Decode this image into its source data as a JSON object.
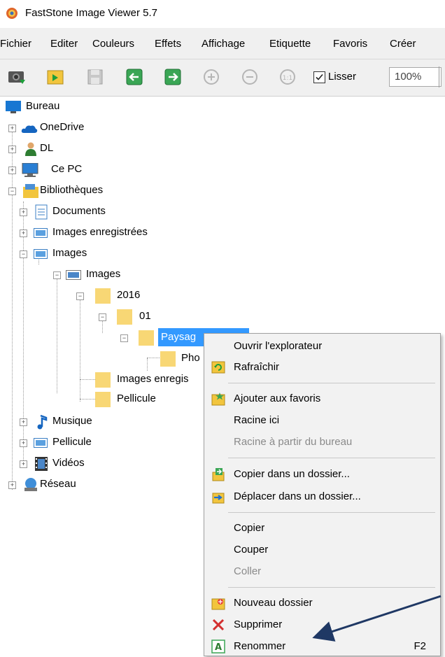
{
  "window": {
    "title": "FastStone Image Viewer 5.7"
  },
  "menubar": {
    "items": [
      "Fichier",
      "Editer",
      "Couleurs",
      "Effets",
      "Affichage",
      "Etiquette",
      "Favoris",
      "Créer"
    ]
  },
  "toolbar": {
    "smooth_label": "Lisser",
    "smooth_checked": true,
    "zoom_value": "100%"
  },
  "tree": {
    "nodes": [
      {
        "label": "Bureau",
        "icon": "desktop-icon"
      },
      {
        "label": "OneDrive",
        "icon": "cloud-icon"
      },
      {
        "label": "DL",
        "icon": "user-icon"
      },
      {
        "label": "Ce PC",
        "icon": "computer-icon"
      },
      {
        "label": "Bibliothèques",
        "icon": "library-icon"
      },
      {
        "label": "Documents",
        "icon": "documents-icon"
      },
      {
        "label": "Images enregistrées",
        "icon": "pictures-icon"
      },
      {
        "label": "Images",
        "icon": "pictures-icon"
      },
      {
        "label": "Images",
        "icon": "pictures-icon"
      },
      {
        "label": "2016",
        "icon": "folder-icon"
      },
      {
        "label": "01",
        "icon": "folder-icon"
      },
      {
        "label": "Paysag",
        "icon": "folder-icon"
      },
      {
        "label": "Pho",
        "icon": "folder-icon"
      },
      {
        "label": "Images enregis",
        "icon": "folder-icon"
      },
      {
        "label": "Pellicule",
        "icon": "folder-icon"
      },
      {
        "label": "Musique",
        "icon": "music-icon"
      },
      {
        "label": "Pellicule",
        "icon": "pictures-icon"
      },
      {
        "label": "Vidéos",
        "icon": "video-icon"
      },
      {
        "label": "Réseau",
        "icon": "network-icon"
      }
    ]
  },
  "context_menu": {
    "items": [
      {
        "label": "Ouvrir l'explorateur",
        "icon": "",
        "disabled": false
      },
      {
        "label": "Rafraîchir",
        "icon": "refresh-icon",
        "disabled": false
      },
      {
        "label": "Ajouter aux favoris",
        "icon": "add-favorite-icon",
        "disabled": false
      },
      {
        "label": "Racine ici",
        "icon": "",
        "disabled": false
      },
      {
        "label": "Racine à partir du bureau",
        "icon": "",
        "disabled": true
      },
      {
        "label": "Copier dans un dossier...",
        "icon": "copy-to-folder-icon",
        "disabled": false
      },
      {
        "label": "Déplacer dans un dossier...",
        "icon": "move-to-folder-icon",
        "disabled": false
      },
      {
        "label": "Copier",
        "icon": "",
        "disabled": false
      },
      {
        "label": "Couper",
        "icon": "",
        "disabled": false
      },
      {
        "label": "Coller",
        "icon": "",
        "disabled": true
      },
      {
        "label": "Nouveau dossier",
        "icon": "new-folder-icon",
        "disabled": false
      },
      {
        "label": "Supprimer",
        "icon": "delete-icon",
        "disabled": false
      },
      {
        "label": "Renommer",
        "icon": "rename-icon",
        "shortcut": "F2",
        "disabled": false
      }
    ]
  },
  "colors": {
    "selection": "#3399ff",
    "folder": "#f8d775",
    "menu_bg": "#f2f2f2",
    "annotation_arrow": "#1f3864"
  }
}
